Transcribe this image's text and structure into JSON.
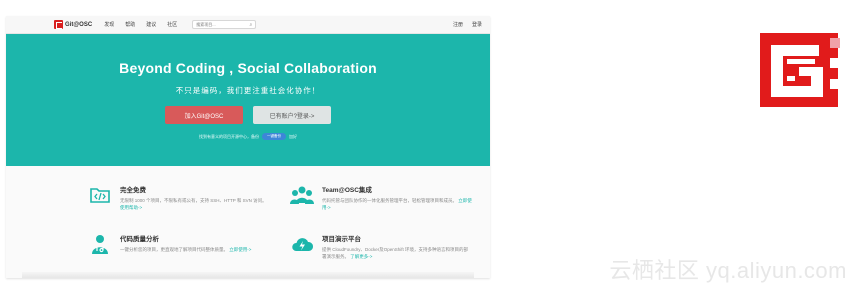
{
  "nav": {
    "brand": "Git@OSC",
    "links": [
      "发现",
      "帮助",
      "建议",
      "社区"
    ],
    "search_placeholder": "搜索项目...",
    "register": "注册",
    "login": "登录"
  },
  "hero": {
    "title": "Beyond Coding , Social Collaboration",
    "subtitle": "不只是编码，我们更注重社会化协作！",
    "join_button": "加入Git@OSC",
    "existing_account_button": "已有账户?登录->",
    "note_prefix": "找到有意义的项目开源中心，备份",
    "note_pill": "一键备份",
    "note_suffix": "加好"
  },
  "features": [
    {
      "icon": "folder-code-icon",
      "title": "完全免费",
      "desc": "无限制 1000 个项目，不限私有或公有，支持 SSH、HTTP 和 SVN 访问。",
      "link": "使用帮助->"
    },
    {
      "icon": "team-icon",
      "title": "Team@OSC集成",
      "desc": "代码托管与团队协作的一体化服务管理平台，轻松管理项目和成员。",
      "link": "立即使用->"
    },
    {
      "icon": "doctor-icon",
      "title": "代码质量分析",
      "desc": "一键分析您的项目，更直观地了解项目代码整体质量。",
      "link": "立即使用->"
    },
    {
      "icon": "cloud-bolt-icon",
      "title": "项目演示平台",
      "desc": "提供 CloudFoundry、Docker及OpenShift 环境，支持多种语言和项目的部署演示服务。",
      "link": "了解更多->"
    }
  ],
  "watermark": "云栖社区 yq.aliyun.com",
  "colors": {
    "teal": "#1cb6ab",
    "red": "#d85a5a",
    "logo_red": "#d91f1f",
    "pill_blue": "#3d86d8"
  }
}
